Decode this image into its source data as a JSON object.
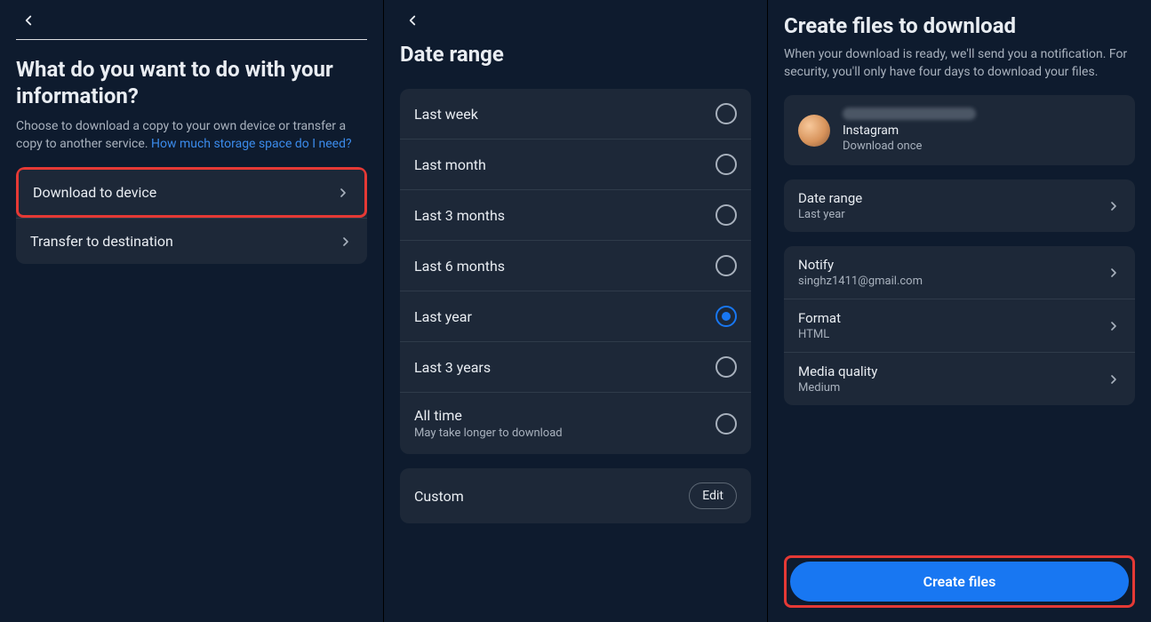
{
  "pane1": {
    "title": "What do you want to do with your information?",
    "subtitle_plain": "Choose to download a copy to your own device or transfer a copy to another service. ",
    "subtitle_link": "How much storage space do I need?",
    "options": [
      {
        "label": "Download to device",
        "highlighted": true
      },
      {
        "label": "Transfer to destination",
        "highlighted": false
      }
    ]
  },
  "pane2": {
    "title": "Date range",
    "options": [
      {
        "label": "Last week",
        "sub": "",
        "selected": false
      },
      {
        "label": "Last month",
        "sub": "",
        "selected": false
      },
      {
        "label": "Last 3 months",
        "sub": "",
        "selected": false
      },
      {
        "label": "Last 6 months",
        "sub": "",
        "selected": false
      },
      {
        "label": "Last year",
        "sub": "",
        "selected": true
      },
      {
        "label": "Last 3 years",
        "sub": "",
        "selected": false
      },
      {
        "label": "All time",
        "sub": "May take longer to download",
        "selected": false
      }
    ],
    "custom_label": "Custom",
    "edit_label": "Edit"
  },
  "pane3": {
    "title": "Create files to download",
    "subtitle": "When your download is ready, we'll send you a notification. For security, you'll only have four days to download your files.",
    "account": {
      "platform": "Instagram",
      "frequency": "Download once"
    },
    "settings": [
      {
        "key": "Date range",
        "value": "Last year"
      },
      {
        "key": "Notify",
        "value": "singhz1411@gmail.com"
      },
      {
        "key": "Format",
        "value": "HTML"
      },
      {
        "key": "Media quality",
        "value": "Medium"
      }
    ],
    "cta": "Create files"
  }
}
